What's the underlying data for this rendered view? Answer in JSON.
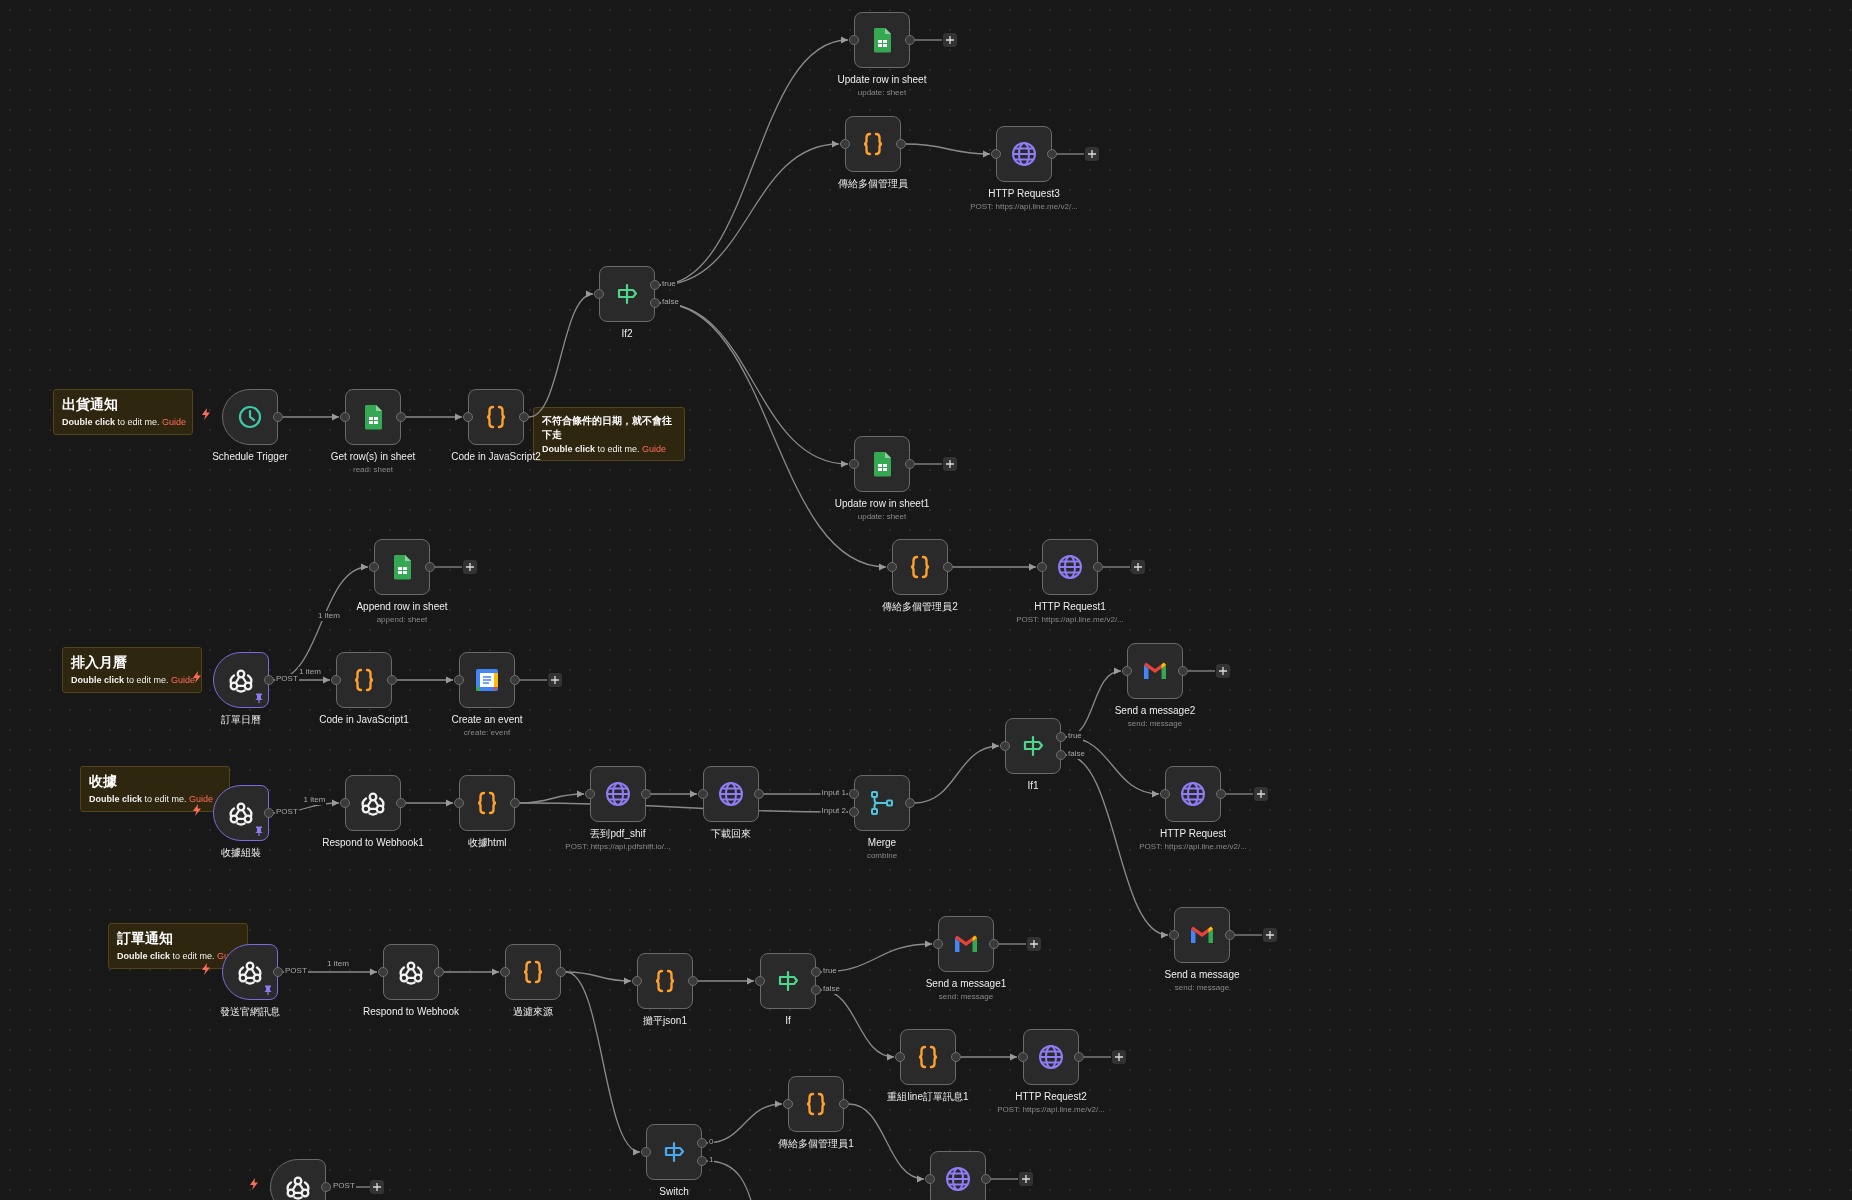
{
  "canvas": {
    "sticky_notes": [
      {
        "title": "出貨通知",
        "body": "**Double click** to edit me.",
        "link": "Guide"
      },
      {
        "title": "不符合條件的日期，就不會往下走",
        "body": "**Double click** to edit me.",
        "link": "Guide"
      },
      {
        "title": "排入月曆",
        "body": "**Double click** to edit me.",
        "link": "Guide"
      },
      {
        "title": "收據",
        "body": "**Double click** to edit me.",
        "link": "Guide"
      },
      {
        "title": "訂單通知",
        "body": "**Double click** to edit me.",
        "link": "Gu"
      }
    ],
    "nodes": [
      {
        "kind": "schedule-trigger",
        "title": "Schedule Trigger",
        "add_button": false
      },
      {
        "kind": "sheets",
        "title": "Get row(s) in sheet",
        "subtitle": "read: sheet",
        "add_button": false
      },
      {
        "kind": "code",
        "title": "Code in JavaScript2",
        "add_button": false
      },
      {
        "kind": "if",
        "title": "If2",
        "outputs": [
          "true",
          "false"
        ],
        "add_button": false
      },
      {
        "kind": "sheets",
        "title": "Update row in sheet",
        "subtitle": "update: sheet",
        "add_button": true
      },
      {
        "kind": "code",
        "title": "傳給多個管理員",
        "add_button": false
      },
      {
        "kind": "http",
        "title": "HTTP Request3",
        "subtitle": "POST: https://api.line.me/v2/...",
        "add_button": true
      },
      {
        "kind": "sheets",
        "title": "Update row in sheet1",
        "subtitle": "update: sheet",
        "add_button": true
      },
      {
        "kind": "sheets",
        "title": "Append row in sheet",
        "subtitle": "append: sheet",
        "add_button": true
      },
      {
        "kind": "code",
        "title": "傳給多個管理員2",
        "add_button": false
      },
      {
        "kind": "http",
        "title": "HTTP Request1",
        "subtitle": "POST: https://api.line.me/v2/...",
        "add_button": true
      },
      {
        "kind": "webhook-trigger",
        "title": "訂單日曆",
        "pinned": true,
        "outputs": [
          "POST"
        ],
        "edge_labels": [
          "1 item",
          "1 item"
        ],
        "add_button": false
      },
      {
        "kind": "code",
        "title": "Code in JavaScript1",
        "add_button": false
      },
      {
        "kind": "calendar",
        "title": "Create an event",
        "subtitle": "create: event",
        "add_button": true
      },
      {
        "kind": "webhook-trigger",
        "title": "收據組裝",
        "pinned": true,
        "outputs": [
          "POST"
        ],
        "edge_labels": [
          "1 item"
        ],
        "add_button": false
      },
      {
        "kind": "webhook",
        "title": "Respond to Webhook1",
        "add_button": false
      },
      {
        "kind": "code",
        "title": "收據html",
        "add_button": false
      },
      {
        "kind": "http",
        "title": "丟到pdf_shif",
        "subtitle": "POST: https://api.pdfshift.io/...",
        "add_button": false
      },
      {
        "kind": "http",
        "title": "下載回來",
        "add_button": false
      },
      {
        "kind": "merge",
        "title": "Merge",
        "subtitle": "combine",
        "inputs": [
          "Input 1",
          "Input 2"
        ],
        "add_button": false
      },
      {
        "kind": "if",
        "title": "If1",
        "outputs": [
          "true",
          "false"
        ],
        "add_button": false
      },
      {
        "kind": "gmail",
        "title": "Send a message2",
        "subtitle": "send: message",
        "add_button": true
      },
      {
        "kind": "http",
        "title": "HTTP Request",
        "subtitle": "POST: https://api.line.me/v2/...",
        "add_button": true
      },
      {
        "kind": "gmail",
        "title": "Send a message",
        "subtitle": "send: message",
        "add_button": true
      },
      {
        "kind": "webhook-trigger",
        "title": "發送官網訊息",
        "pinned": true,
        "outputs": [
          "POST"
        ],
        "edge_labels": [
          "1 item"
        ],
        "add_button": false
      },
      {
        "kind": "webhook",
        "title": "Respond to Webhook",
        "add_button": false
      },
      {
        "kind": "code",
        "title": "過濾來源",
        "add_button": false
      },
      {
        "kind": "code",
        "title": "攤平json1",
        "add_button": false
      },
      {
        "kind": "if",
        "title": "If",
        "outputs": [
          "true",
          "false"
        ],
        "add_button": false
      },
      {
        "kind": "gmail",
        "title": "Send a message1",
        "subtitle": "send: message",
        "add_button": true
      },
      {
        "kind": "code",
        "title": "重組line訂單訊息1",
        "add_button": false
      },
      {
        "kind": "http",
        "title": "HTTP Request2",
        "subtitle": "POST: https://api.line.me/v2/...",
        "add_button": true
      },
      {
        "kind": "switch",
        "title": "Switch",
        "outputs": [
          "0",
          "1"
        ],
        "add_button": false
      },
      {
        "kind": "code",
        "title": "傳給多個管理員1",
        "add_button": false
      },
      {
        "kind": "http",
        "add_button": true
      },
      {
        "kind": "webhook-trigger",
        "pinned": false,
        "outputs": [
          "POST"
        ],
        "add_button": true
      }
    ]
  }
}
